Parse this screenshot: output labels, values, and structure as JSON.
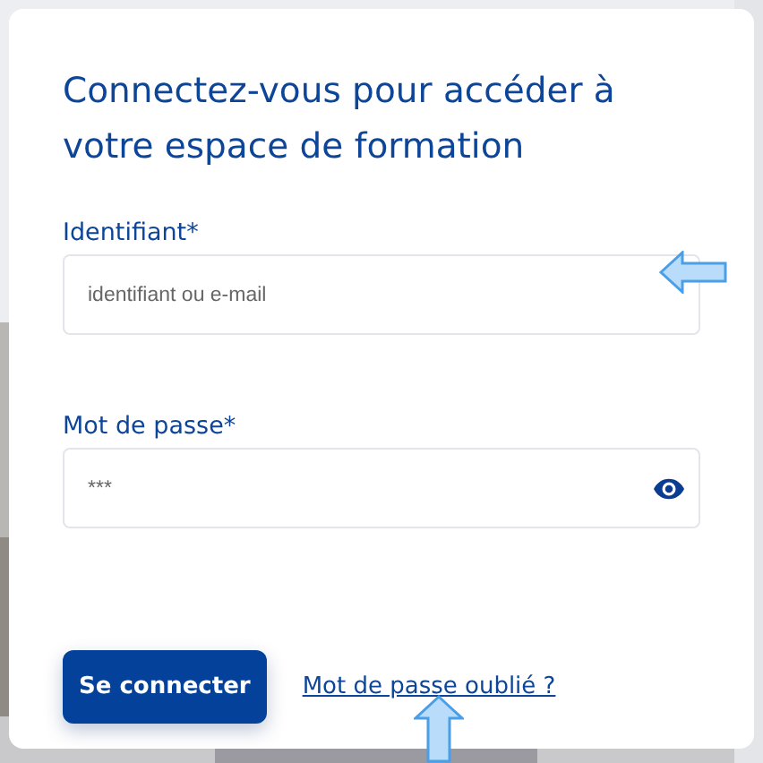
{
  "title": "Connectez-vous pour accéder à votre espace de formation",
  "fields": [
    {
      "label": "Identifiant*",
      "placeholder": "identifiant ou e-mail",
      "kind": "text"
    },
    {
      "label": "Mot de passe*",
      "placeholder": "***",
      "kind": "password"
    }
  ],
  "submit": "Se connecter",
  "forgot_link": "Mot de passe oublié ?"
}
